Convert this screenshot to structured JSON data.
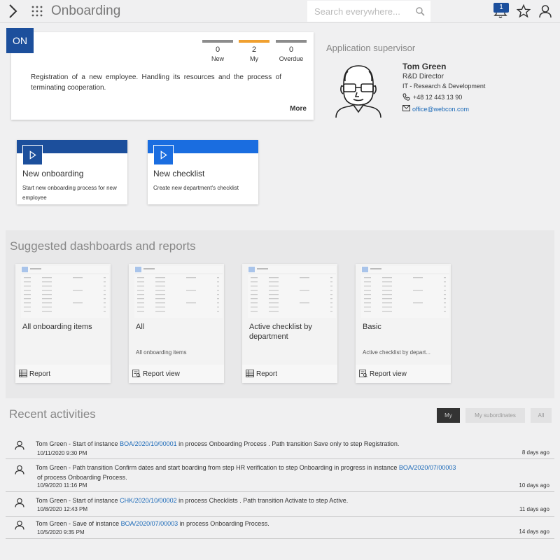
{
  "header": {
    "title": "Onboarding",
    "search_placeholder": "Search everywhere...",
    "notification_count": "1"
  },
  "app_card": {
    "badge": "ON",
    "counters": [
      {
        "value": "0",
        "label": "New",
        "color": "#8c8c8c"
      },
      {
        "value": "2",
        "label": "My",
        "color": "#f0a030"
      },
      {
        "value": "0",
        "label": "Overdue",
        "color": "#8c8c8c"
      }
    ],
    "description": "Registration of a new employee. Handling its resources and the process of terminating cooperation.",
    "more_label": "More"
  },
  "supervisor": {
    "heading": "Application supervisor",
    "name": "Tom Green",
    "role": "R&D Director",
    "department": "IT - Research & Development",
    "phone": "+48 12 443 13 90",
    "email": "office@webcon.com"
  },
  "start_tiles": [
    {
      "name": "New onboarding",
      "description": "Start new onboarding process for new employee",
      "color": "#1c4f9c"
    },
    {
      "name": "New checklist",
      "description": "Create new department's checklist",
      "color": "#1a6de0"
    }
  ],
  "dashboards": {
    "title": "Suggested dashboards and reports",
    "items": [
      {
        "name": "All onboarding items",
        "subtitle": "",
        "footer": "Report",
        "icon": "report-grid-icon"
      },
      {
        "name": "All",
        "subtitle": "All onboarding items",
        "footer": "Report view",
        "icon": "report-view-icon"
      },
      {
        "name": "Active checklist by department",
        "subtitle": "",
        "footer": "Report",
        "icon": "report-grid-icon"
      },
      {
        "name": "Basic",
        "subtitle": "Active checklist by depart...",
        "footer": "Report view",
        "icon": "report-view-icon"
      }
    ]
  },
  "recent": {
    "title": "Recent activities",
    "filters": [
      {
        "label": "My",
        "active": true
      },
      {
        "label": "My subordinates",
        "active": false
      },
      {
        "label": "All",
        "active": false
      }
    ],
    "items": [
      {
        "actor": "Tom Green",
        "a1": " - Start of instance ",
        "l1": "BOA/2020/10/00001",
        "a2": " in process ",
        "b1": "Onboarding Process",
        "a3": " . Path transition ",
        "b2": "Save only",
        "a4": " to step ",
        "b3": "Registration.",
        "timestamp": "10/11/2020 9:30 PM",
        "ago": "8 days ago"
      },
      {
        "actor": "Tom Green",
        "a1": " - Path transition ",
        "b1": "Confirm dates and start boarding",
        "a2": " from step ",
        "b2": "HR verification",
        "a3": " to step ",
        "b3": "Onboarding in progress",
        "a4": " in instance ",
        "l1": "BOA/2020/07/00003",
        "line2a": "of process ",
        "line2b": "Onboarding Process.",
        "timestamp": "10/9/2020 11:16 PM",
        "ago": "10 days ago"
      },
      {
        "actor": "Tom Green",
        "a1": " - Start of instance ",
        "l1": "CHK/2020/10/00002",
        "a2": " in process ",
        "b1": "Checklists",
        "a3": " . Path transition ",
        "b2": "Activate",
        "a4": " to step ",
        "b3": "Active.",
        "timestamp": "10/8/2020 12:43 PM",
        "ago": "11 days ago"
      },
      {
        "actor": "Tom Green",
        "a1": " - Save of instance ",
        "l1": "BOA/2020/07/00003",
        "a2": " in process ",
        "b1": "Onboarding Process.",
        "timestamp": "10/5/2020 9:35 PM",
        "ago": "14 days ago"
      }
    ]
  }
}
